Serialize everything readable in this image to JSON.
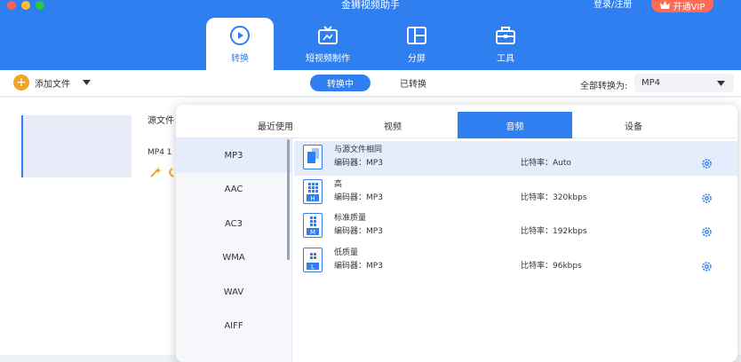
{
  "app": {
    "title": "金狮视频助手",
    "login": "登录/注册",
    "vip": "开通VIP"
  },
  "colors": {
    "accent": "#2f7ff0",
    "vip": "#ff6a55",
    "add": "#f5a524"
  },
  "nav": [
    {
      "label": "转换",
      "icon": "convert-play-icon",
      "active": true
    },
    {
      "label": "短视频制作",
      "icon": "tv-clip-icon",
      "active": false
    },
    {
      "label": "分屏",
      "icon": "split-screen-icon",
      "active": false
    },
    {
      "label": "工具",
      "icon": "toolbox-icon",
      "active": false
    }
  ],
  "toolbar": {
    "add_label": "添加文件",
    "seg_converting": "转换中",
    "seg_converted": "已转换",
    "convert_all_label": "全部转换为:",
    "convert_all_value": "MP4"
  },
  "file": {
    "source_label": "源文件：",
    "format_meta": "MP4 1"
  },
  "panel": {
    "tabs": [
      "最近使用",
      "视频",
      "音频",
      "设备"
    ],
    "active_tab": "音频",
    "formats": [
      "MP3",
      "AAC",
      "AC3",
      "WMA",
      "WAV",
      "AIFF"
    ],
    "selected_format": "MP3",
    "presets": [
      {
        "name": "与源文件相同",
        "encoder": "编码器：MP3",
        "bitrate": "比特率：Auto",
        "badge": ""
      },
      {
        "name": "高",
        "encoder": "编码器：MP3",
        "bitrate": "比特率：320kbps",
        "badge": "H"
      },
      {
        "name": "标准质量",
        "encoder": "编码器：MP3",
        "bitrate": "比特率：192kbps",
        "badge": "M"
      },
      {
        "name": "低质量",
        "encoder": "编码器：MP3",
        "bitrate": "比特率：96kbps",
        "badge": "L"
      }
    ]
  }
}
